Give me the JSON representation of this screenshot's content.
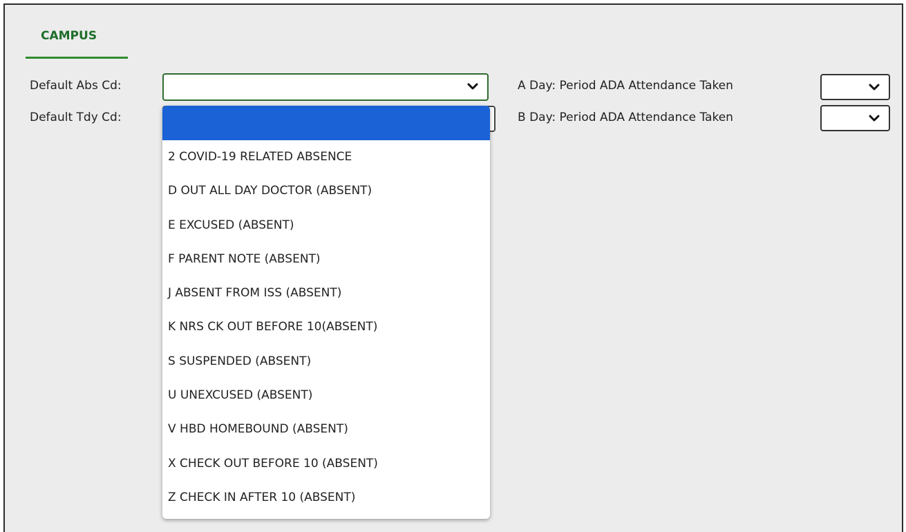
{
  "tab": {
    "label": "CAMPUS"
  },
  "form": {
    "default_abs_label": "Default Abs Cd:",
    "default_tdy_label": "Default Tdy Cd:",
    "a_day_label": "A Day: Period ADA Attendance Taken",
    "b_day_label": "B Day: Period ADA Attendance Taken",
    "default_abs_value": "",
    "default_tdy_value": ""
  },
  "dropdown": {
    "options": [
      "2 COVID-19 RELATED ABSENCE",
      "D OUT ALL DAY DOCTOR (ABSENT)",
      "E EXCUSED (ABSENT)",
      "F PARENT NOTE (ABSENT)",
      "J ABSENT FROM ISS (ABSENT)",
      "K NRS CK OUT BEFORE 10(ABSENT)",
      "S SUSPENDED (ABSENT)",
      "U UNEXCUSED (ABSENT)",
      "V HBD HOMEBOUND (ABSENT)",
      "X CHECK OUT BEFORE 10 (ABSENT)",
      "Z CHECK IN AFTER 10 (ABSENT)"
    ]
  },
  "colors": {
    "tab_accent": "#2e8b2e",
    "selected_option": "#1a62d6",
    "focus_border": "#2f6b2f"
  }
}
